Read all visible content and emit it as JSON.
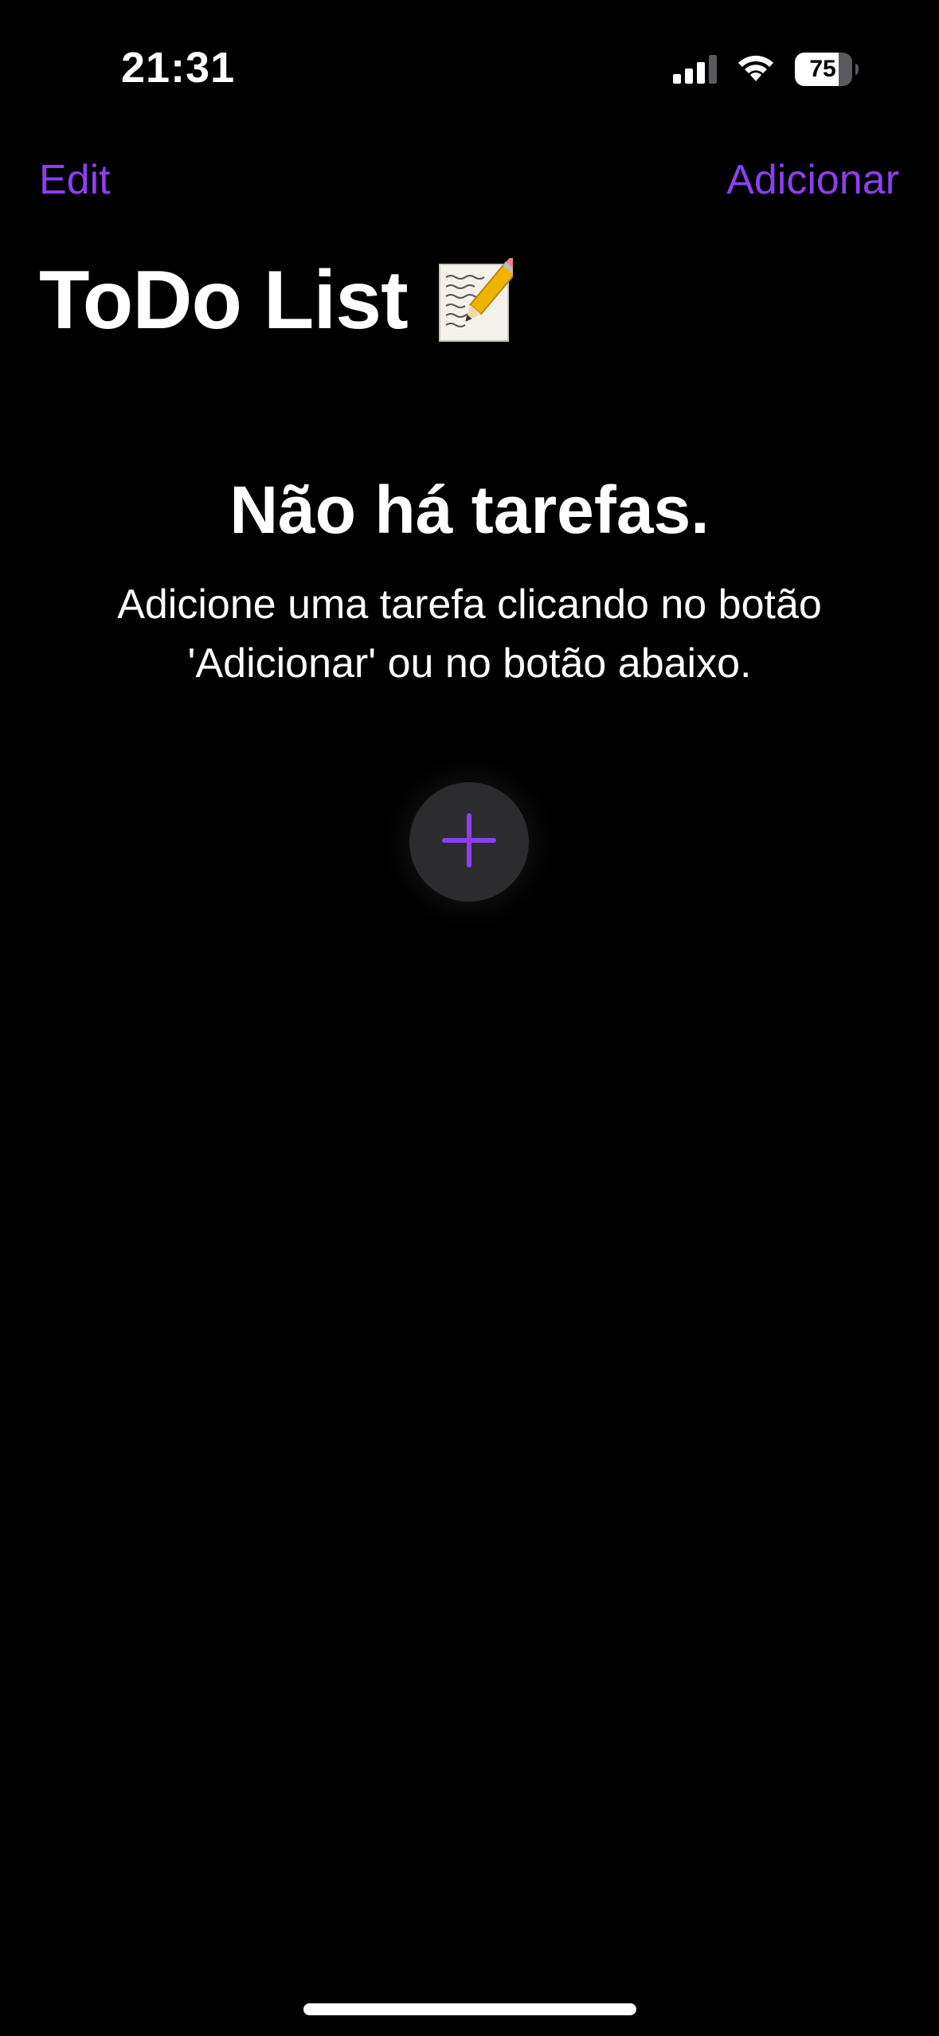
{
  "status_bar": {
    "time": "21:31",
    "battery": "75",
    "icons": [
      "signal-icon",
      "wifi-icon",
      "battery-icon"
    ]
  },
  "nav": {
    "edit_label": "Edit",
    "add_label": "Adicionar"
  },
  "page": {
    "title": "ToDo List",
    "title_icon": "memo-icon"
  },
  "empty_state": {
    "title": "Não há tarefas.",
    "description": "Adicione uma tarefa clicando no botão 'Adicionar' ou no botão abaixo."
  },
  "add_button": {
    "icon": "plus-icon"
  },
  "colors": {
    "accent": "#8d3ff0",
    "background": "#000000",
    "button_bg": "#2c2c2e"
  }
}
